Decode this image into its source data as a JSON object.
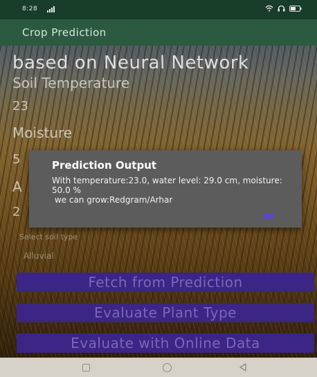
{
  "status_bar": {
    "time": "8:28"
  },
  "app_bar": {
    "title": "Crop Prediction"
  },
  "main": {
    "heading_line2": "based on Neural Network",
    "soil_temperature_label": "Soil Temperature",
    "soil_temperature_value": "23",
    "moisture_label": "Moisture",
    "moisture_value_partial": "5",
    "third_label_partial": "A",
    "third_value_partial": "2",
    "soil_type_label": "Select soil type",
    "soil_type_value": "Alluvial"
  },
  "dialog": {
    "title": "Prediction Output",
    "message": "With temperature:23.0, water level: 29.0 cm, moisture: 50.0 %\n we can grow:Redgram/Arhar"
  },
  "buttons": {
    "fetch_prediction": "Fetch from Prediction",
    "evaluate_plant": "Evaluate Plant Type",
    "evaluate_online": "Evaluate with Online Data"
  },
  "colors": {
    "status_bar": "#183d29",
    "app_bar": "#2c5a40",
    "button_bg": "#3b2585",
    "dialog_bg": "#5c5c5c",
    "dialog_ok": "#5a48c8"
  },
  "icons": {
    "status_bar": [
      "signal-icon",
      "wifi-icon",
      "headphones-icon",
      "battery-icon"
    ],
    "nav_bar": [
      "recent-apps-icon",
      "home-icon",
      "back-icon"
    ]
  }
}
